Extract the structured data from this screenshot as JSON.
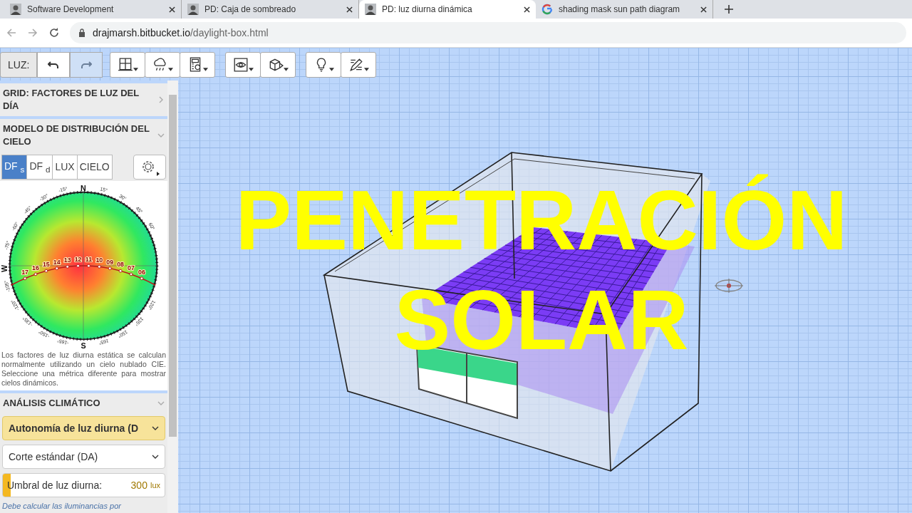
{
  "browser": {
    "tabs": [
      {
        "title": "Software Development",
        "kind": "avatar",
        "selected": false
      },
      {
        "title": "PD: Caja de sombreado",
        "kind": "avatar",
        "selected": false
      },
      {
        "title": "PD: luz diurna dinámica",
        "kind": "avatar",
        "selected": true
      },
      {
        "title": "shading mask sun path diagram",
        "kind": "search",
        "selected": false
      }
    ],
    "address": {
      "host": "drajmarsh.bitbucket.io",
      "path": "/daylight-box.html"
    }
  },
  "toolbar": {
    "label": "LUZ:",
    "undo_enabled": true,
    "redo_enabled": false,
    "groups": [
      {
        "buttons": [
          {
            "kind": "window"
          },
          {
            "kind": "weather"
          },
          {
            "kind": "calculator"
          }
        ]
      },
      {
        "buttons": [
          {
            "kind": "view"
          },
          {
            "kind": "cube"
          }
        ]
      },
      {
        "buttons": [
          {
            "kind": "bulb"
          },
          {
            "kind": "pen"
          }
        ]
      }
    ]
  },
  "sidebar": {
    "panels": [
      {
        "title": "GRID: FACTORES DE LUZ DEL DÍA",
        "expanded": false
      },
      {
        "title": "MODELO DE DISTRIBUCIÓN DEL CIELO",
        "expanded": true
      }
    ],
    "metric_tabs": [
      {
        "label": "DF $_{s}$",
        "selected": true
      },
      {
        "label": "DF $_{d}$",
        "selected": false
      },
      {
        "label": "LUX",
        "selected": false
      },
      {
        "label": "CIELO",
        "selected": false
      }
    ],
    "sky_dome": {
      "compass": {
        "north": "N",
        "south": "S",
        "west": "W"
      },
      "azimuth_labels": [
        "15°",
        "30°",
        "45°",
        "60°",
        "120°",
        "135°",
        "150°",
        "165°",
        "-165°",
        "-150°",
        "-135°",
        "-120°",
        "-105°",
        "-75°",
        "-60°",
        "-45°",
        "-30°",
        "-15°"
      ],
      "hour_labels": [
        "17",
        "16",
        "15",
        "14",
        "13",
        "12",
        "11",
        "10",
        "09",
        "08",
        "07",
        "06"
      ]
    },
    "description": "Los factores de luz diurna estática se calculan normalmente utilizando un cielo nublado CIE. Seleccione una métrica diferente para mostrar cielos dinámicos.",
    "climate_panel": {
      "title": "ANÁLISIS CLIMÁTICO",
      "expanded": true
    },
    "metric_select": "Autonomía de luz diurna (D",
    "mode_select": "Corte estándar (DA)",
    "threshold": {
      "label": "Umbral de luz diurna:",
      "value": "300",
      "unit": "lux",
      "level": 0.05
    },
    "note": "Debe calcular las iluminancias por"
  },
  "overlay_title": [
    "PENETRACIÓN",
    "SOLAR"
  ]
}
